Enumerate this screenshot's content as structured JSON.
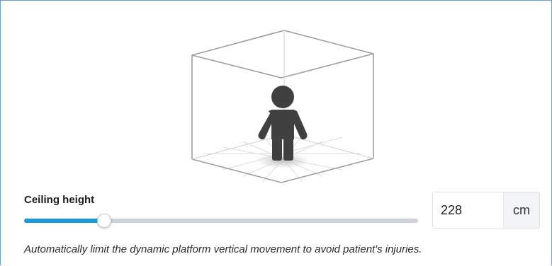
{
  "ceiling": {
    "label": "Ceiling height",
    "value": "228",
    "unit": "cm",
    "slider_fraction": 0.19,
    "help_text": "Automatically limit the dynamic platform vertical movement to avoid patient's injuries."
  },
  "illustration": {
    "icon": "person-in-room-icon"
  },
  "colors": {
    "accent": "#1b9ad8",
    "track": "#cfd2d6",
    "frame_border": "#6a9fd4",
    "figure": "#404040"
  }
}
